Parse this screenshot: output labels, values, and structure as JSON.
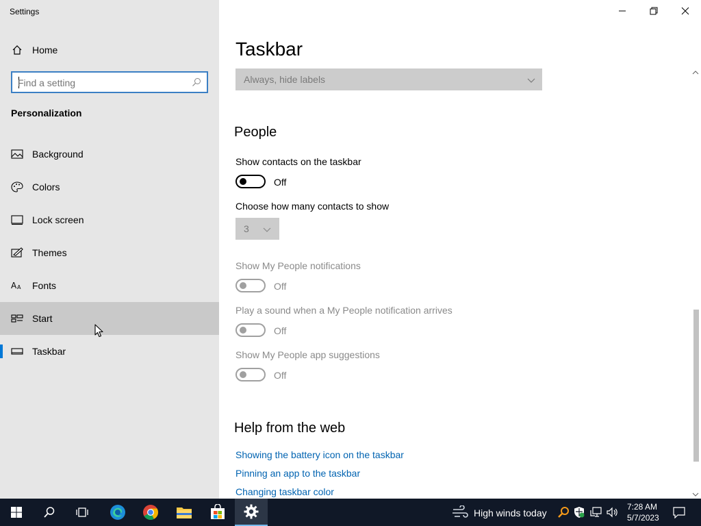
{
  "app": {
    "title": "Settings"
  },
  "window": {
    "minimize": "minimize",
    "restore": "restore",
    "close": "close"
  },
  "sidebar": {
    "home_label": "Home",
    "search": {
      "placeholder": "Find a setting",
      "value": ""
    },
    "section_title": "Personalization",
    "items": [
      {
        "label": "Background",
        "icon": "background-icon"
      },
      {
        "label": "Colors",
        "icon": "palette-icon"
      },
      {
        "label": "Lock screen",
        "icon": "lock-screen-icon"
      },
      {
        "label": "Themes",
        "icon": "themes-icon"
      },
      {
        "label": "Fonts",
        "icon": "fonts-icon"
      },
      {
        "label": "Start",
        "icon": "start-icon",
        "state": "hover"
      },
      {
        "label": "Taskbar",
        "icon": "taskbar-icon",
        "state": "selected"
      }
    ],
    "accent_color": "#0078d7"
  },
  "main": {
    "title": "Taskbar",
    "labels_dropdown": {
      "value": "Always, hide labels",
      "disabled": true
    },
    "people": {
      "heading": "People",
      "show_contacts": {
        "label": "Show contacts on the taskbar",
        "state": "Off",
        "disabled": false
      },
      "contacts_count": {
        "label": "Choose how many contacts to show",
        "value": "3",
        "disabled": true
      },
      "notifications": {
        "label": "Show My People notifications",
        "state": "Off",
        "disabled": true
      },
      "sound": {
        "label": "Play a sound when a My People notification arrives",
        "state": "Off",
        "disabled": true
      },
      "suggestions": {
        "label": "Show My People app suggestions",
        "state": "Off",
        "disabled": true
      }
    },
    "help": {
      "heading": "Help from the web",
      "links": [
        "Showing the battery icon on the taskbar",
        "Pinning an app to the taskbar",
        "Changing taskbar color"
      ]
    }
  },
  "taskbar": {
    "apps": [
      "windows-start",
      "search",
      "task-view",
      "edge",
      "chrome",
      "file-explorer",
      "microsoft-store",
      "settings"
    ],
    "active_app": "settings",
    "weather": "High winds today",
    "time": "7:28 AM",
    "date": "5/7/2023"
  }
}
